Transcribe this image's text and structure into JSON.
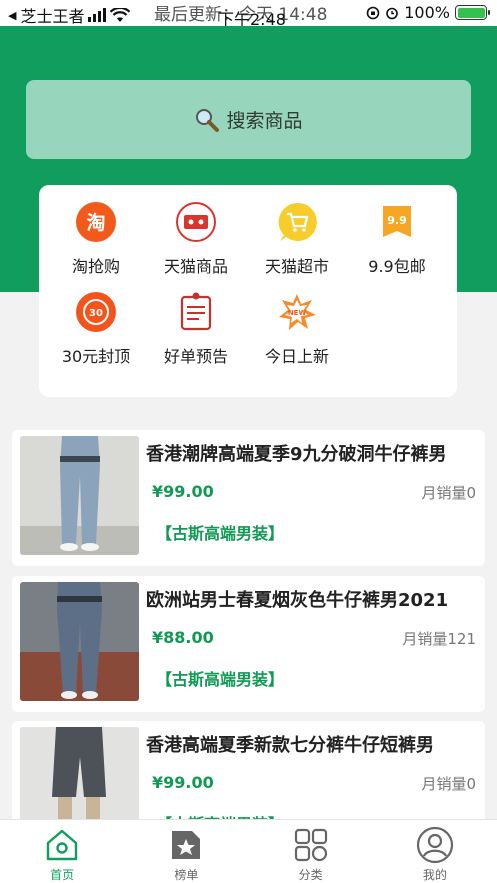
{
  "status_bar": {
    "back_app": "芝士王者",
    "overlay_text": "最后更新：今天 14:48",
    "time": "下午2:48",
    "battery": "100%"
  },
  "search": {
    "placeholder": "搜索商品"
  },
  "categories": [
    {
      "label": "淘抢购",
      "icon": "taobao-icon",
      "glyph": "淘"
    },
    {
      "label": "天猫商品",
      "icon": "tmall-icon"
    },
    {
      "label": "天猫超市",
      "icon": "cart-icon"
    },
    {
      "label": "9.9包邮",
      "icon": "tag-icon",
      "glyph": "9.9"
    },
    {
      "label": "30元封顶",
      "icon": "30-badge-icon",
      "glyph": "30"
    },
    {
      "label": "好单预告",
      "icon": "notice-icon"
    },
    {
      "label": "今日上新",
      "icon": "new-burst-icon",
      "glyph": "NEW"
    }
  ],
  "products": [
    {
      "title": "香港潮牌高端夏季9九分破洞牛仔裤男",
      "price": "¥99.00",
      "sales": "月销量0",
      "shop": "【古斯高端男装】"
    },
    {
      "title": "欧洲站男士春夏烟灰色牛仔裤男2021",
      "price": "¥88.00",
      "sales": "月销量121",
      "shop": "【古斯高端男装】"
    },
    {
      "title": "香港高端夏季新款七分裤牛仔短裤男",
      "price": "¥99.00",
      "sales": "月销量0",
      "shop": "【古斯高端男装】"
    }
  ],
  "bottom_nav": [
    {
      "label": "首页",
      "icon": "home-icon",
      "active": true
    },
    {
      "label": "榜单",
      "icon": "ranking-icon",
      "active": false
    },
    {
      "label": "分类",
      "icon": "category-grid-icon",
      "active": false
    },
    {
      "label": "我的",
      "icon": "profile-icon",
      "active": false
    }
  ],
  "colors": {
    "brand_green": "#109d5d",
    "price_green": "#129a55",
    "search_bg": "#97d6bc"
  }
}
